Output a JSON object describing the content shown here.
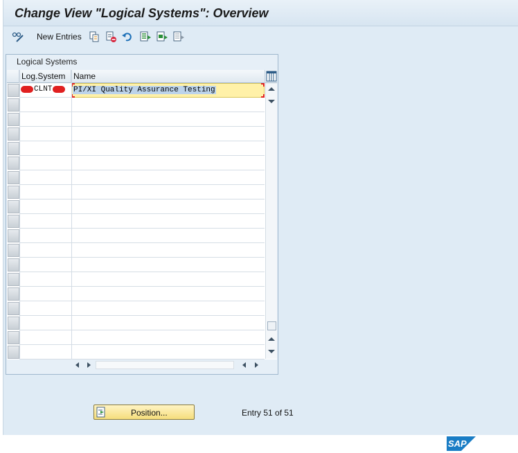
{
  "window": {
    "title": "Change View \"Logical Systems\": Overview"
  },
  "toolbar": {
    "items": [
      {
        "icon": "glasses-pencil-icon"
      },
      {
        "label": "New Entries",
        "icon": "new-entries"
      },
      {
        "icon": "copy-icon"
      },
      {
        "icon": "delete-icon"
      },
      {
        "icon": "undo-icon"
      },
      {
        "icon": "select-all-icon"
      },
      {
        "icon": "select-block-icon"
      },
      {
        "icon": "deselect-all-icon"
      }
    ]
  },
  "panel": {
    "title": "Logical Systems"
  },
  "table": {
    "columns": [
      "Log.System",
      "Name"
    ],
    "rows": [
      {
        "log_system": "CLNT",
        "name": "PI/XI Quality Assurance Testing"
      }
    ],
    "empty_row_count": 18
  },
  "footer": {
    "position_button": "Position...",
    "entry_info": "Entry 51 of 51"
  },
  "branding": {
    "logo": "SAP"
  },
  "colors": {
    "background": "#dfebf5",
    "button_yellow": "#f5dd7c",
    "input_yellow": "#fff1a8",
    "selection_blue": "#bcd3ea",
    "redaction": "#e02020",
    "sap_blue": "#1a7dc5"
  }
}
